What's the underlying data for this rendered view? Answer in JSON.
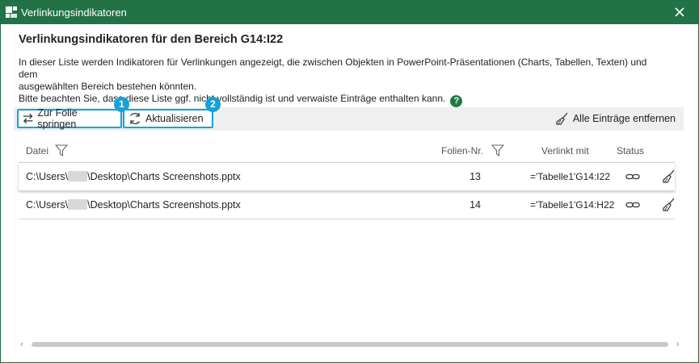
{
  "window": {
    "title": "Verlinkungsindikatoren"
  },
  "heading": "Verlinkungsindikatoren für den Bereich G14:I22",
  "description": {
    "line1": "In dieser Liste werden Indikatoren für Verlinkungen angezeigt, die zwischen Objekten in PowerPoint-Präsentationen (Charts, Tabellen, Texten) und dem",
    "line2": "ausgewählten Bereich bestehen könnten.",
    "line3": "Bitte beachten Sie, dass diese Liste ggf. nicht vollständig ist und verwaiste Einträge enthalten kann.",
    "help": "?"
  },
  "toolbar": {
    "goto_label": "Zur Folie springen",
    "refresh_label": "Aktualisieren",
    "clear_all_label": "Alle Einträge entfernen",
    "badge1": "1",
    "badge2": "2"
  },
  "grid": {
    "columns": {
      "file": "Datei",
      "slide": "Folien-Nr.",
      "linked": "Verlinkt mit",
      "status": "Status"
    },
    "rows": [
      {
        "path_prefix": "C:\\Users\\",
        "path_suffix": "\\Desktop\\Charts Screenshots.pptx",
        "slide": "13",
        "linked": "='Tabelle1'G14:I22"
      },
      {
        "path_prefix": "C:\\Users\\",
        "path_suffix": "\\Desktop\\Charts Screenshots.pptx",
        "slide": "14",
        "linked": "='Tabelle1'G14:H22"
      }
    ]
  },
  "colors": {
    "titlebar": "#217346",
    "accent": "#14a3d6",
    "help": "#1e7b3e"
  },
  "icons": {
    "app": "app-icon",
    "close": "close-icon",
    "goto": "swap-arrows-icon",
    "refresh": "refresh-icon",
    "broom": "broom-icon",
    "filter": "filter-icon",
    "link": "link-icon"
  }
}
